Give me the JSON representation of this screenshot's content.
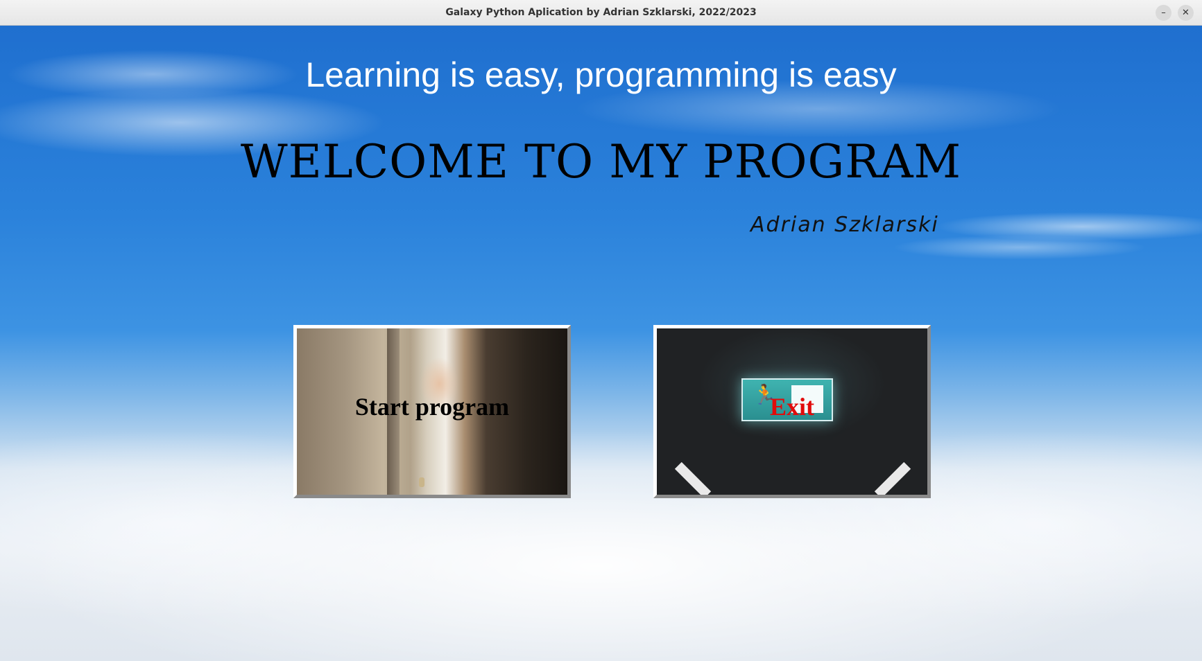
{
  "window": {
    "title": "Galaxy Python Aplication by Adrian Szklarski, 2022/2023",
    "minimize_glyph": "–",
    "close_glyph": "✕"
  },
  "main": {
    "tagline": "Learning is easy, programming is easy",
    "welcome": "WELCOME TO MY PROGRAM",
    "author": "Adrian Szklarski"
  },
  "buttons": {
    "start_label": "Start program",
    "exit_label": "Exit"
  },
  "icons": {
    "runner": "🏃"
  },
  "colors": {
    "exit_text": "#e10b0b",
    "start_text": "#000000",
    "sky": "#2b82db"
  }
}
